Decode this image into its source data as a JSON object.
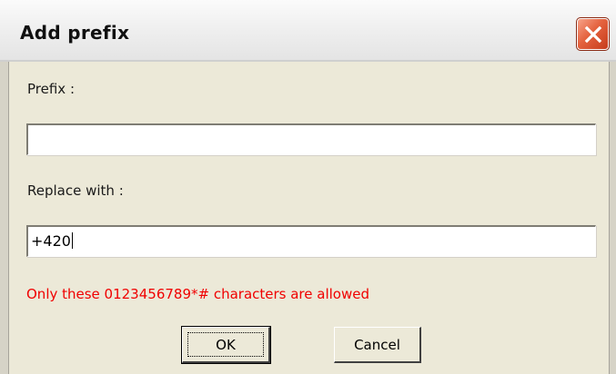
{
  "window": {
    "title": "Add prefix",
    "close_icon": "close-icon"
  },
  "prefix": {
    "label": "Prefix :",
    "value": ""
  },
  "replace": {
    "label": "Replace with :",
    "value": "+420"
  },
  "validation": {
    "message": "Only these 0123456789*# characters are allowed",
    "color": "#f00000"
  },
  "buttons": {
    "ok_label": "OK",
    "cancel_label": "Cancel"
  }
}
